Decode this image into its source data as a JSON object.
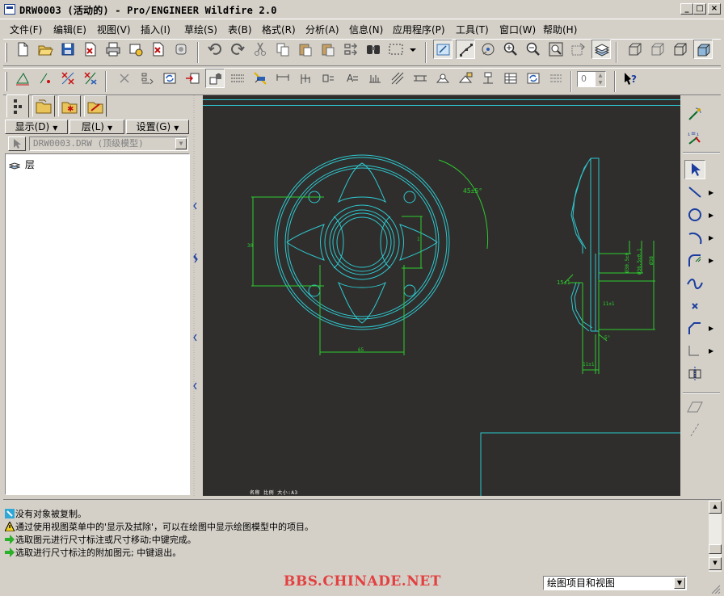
{
  "window": {
    "title": "DRW0003 (活动的) - Pro/ENGINEER Wildfire 2.0",
    "controls": {
      "minimize": "_",
      "maximize": "□",
      "close": "×"
    }
  },
  "menu": [
    "文件(F)",
    "编辑(E)",
    "视图(V)",
    "插入(I)",
    "草绘(S)",
    "表(B)",
    "格式(R)",
    "分析(A)",
    "信息(N)",
    "应用程序(P)",
    "工具(T)",
    "窗口(W)",
    "帮助(H)"
  ],
  "toolbar1_icons": [
    "new-icon",
    "open-icon",
    "save-icon",
    "save-copy-icon",
    "print-icon",
    "email-icon",
    "pdf-icon",
    "pdf-print-icon",
    "undo-icon",
    "redo-icon",
    "cut-icon",
    "copy-icon",
    "paste-icon",
    "paste-special-icon",
    "regenerate-icon",
    "find-icon",
    "select-box-icon",
    "datum-display-icon",
    "datum-axis-icon",
    "spin-center-icon",
    "zoom-in-icon",
    "zoom-out-icon",
    "refit-icon",
    "repaint-icon",
    "layers-icon",
    "wireframe-icon",
    "hidden-line-icon",
    "no-hidden-icon",
    "shading-icon"
  ],
  "toolbar2_icons": [
    "sketch-line-icon",
    "sketch-point-icon",
    "sketch-trim-icon",
    "sketch-delete-icon",
    "erase-icon",
    "detail-icon",
    "regen-view-icon",
    "move-view-icon",
    "lock-view-icon",
    "table-icon",
    "show-erase-icon",
    "dimension-icon",
    "ordinate-icon",
    "reference-icon",
    "note-icon",
    "balloon-icon",
    "hatch-icon",
    "surface-finish-icon",
    "symbol-icon",
    "custom-symbol-icon",
    "datum-tag-icon",
    "bom-icon",
    "update-icon",
    "format-icon"
  ],
  "stepper_value": "0",
  "help_icon": "whats-this-icon",
  "left_panel": {
    "buttons": [
      "显示(D)",
      "层(L)",
      "设置(G)"
    ],
    "model_combo": "DRW0003.DRW (顶级模型)",
    "tree_items": [
      "层"
    ]
  },
  "canvas": {
    "background": "#2f2e2c",
    "status_text": "名称  比例  大小:A3"
  },
  "messages": [
    {
      "icon": "info-icon",
      "text": "没有对象被复制。"
    },
    {
      "icon": "warning-icon",
      "text": "通过使用视图菜单中的'显示及拭除'，可以在绘图中显示绘图模型中的项目。"
    },
    {
      "icon": "prompt-icon",
      "text": "选取图元进行尺寸标注或尺寸移动;中键完成。"
    },
    {
      "icon": "prompt-icon",
      "text": "选取进行尺寸标注的附加图元; 中键退出。"
    }
  ],
  "statusbar": {
    "watermark": "BBS.CHINADE.NET",
    "filter": "绘图项目和视图"
  },
  "right_toolbar_icons": [
    "sketch-tools-icon",
    "relations-icon",
    "select-arrow-icon",
    "line-icon",
    "circle-icon",
    "arc-icon",
    "fillet-icon",
    "spline-icon",
    "point-icon",
    "chamfer-icon",
    "offset-icon",
    "construction-icon",
    "parallel-icon",
    "edge-icon"
  ],
  "dimension_labels": {
    "angle": "45±5°",
    "side_left": "15±1",
    "side_mid": "11±1",
    "side_bottom": "11±1",
    "side_small": "5°",
    "dia1": "Ø30.5±0",
    "dia2": "Ø36.5±0.1",
    "dia3": "Ø38",
    "front_bottom": "65",
    "front_left": "30",
    "front_right": "1"
  }
}
